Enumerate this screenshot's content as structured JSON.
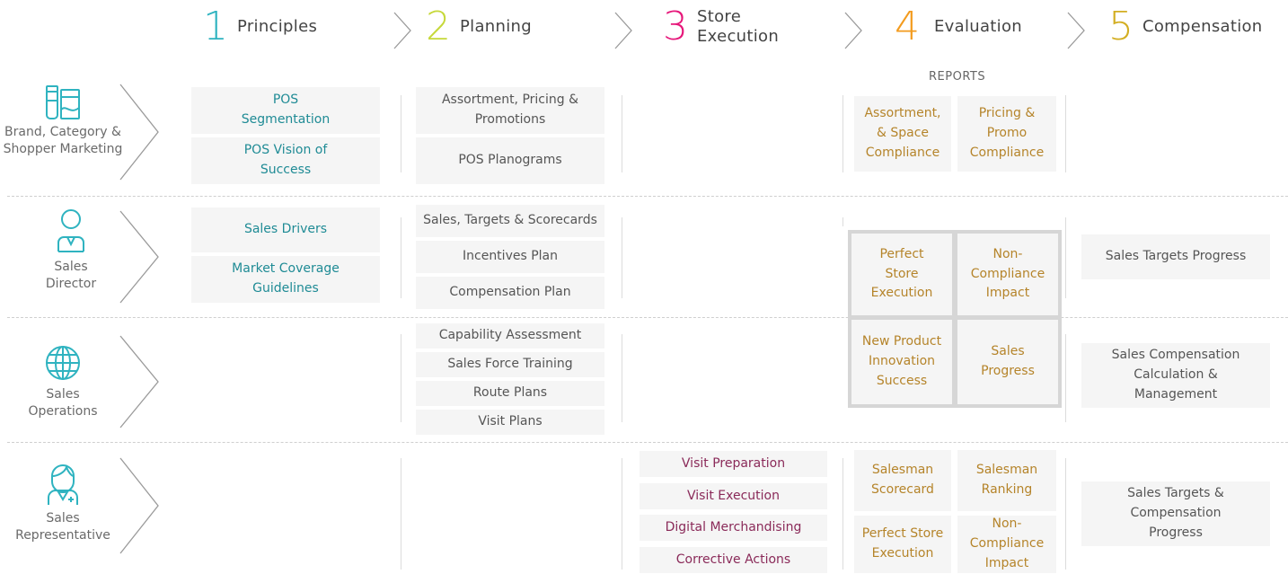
{
  "phases": [
    {
      "num": "1",
      "label": "Principles",
      "color": "#2fb3c0"
    },
    {
      "num": "2",
      "label": "Planning",
      "color": "#c6d83a"
    },
    {
      "num": "3",
      "label": "Store Execution",
      "color": "#e6177a"
    },
    {
      "num": "4",
      "label": "Evaluation",
      "color": "#f39b1e"
    },
    {
      "num": "5",
      "label": "Compensation",
      "color": "#d3ae22"
    }
  ],
  "roles": [
    {
      "label": "Brand, Category & Shopper Marketing",
      "icon": "brand-products-icon"
    },
    {
      "label": "Sales Director",
      "icon": "sales-director-icon"
    },
    {
      "label": "Sales Operations",
      "icon": "globe-icon"
    },
    {
      "label": "Sales Representative",
      "icon": "sales-representative-icon"
    }
  ],
  "principles": {
    "pos_segmentation": "POS Segmentation",
    "pos_vision": "POS Vision of Success",
    "sales_drivers": "Sales Drivers",
    "market_coverage": "Market Coverage Guidelines"
  },
  "planning": {
    "assortment": "Assortment, Pricing & Promotions",
    "planograms": "POS Planograms",
    "targets": "Sales, Targets & Scorecards",
    "incentives": "Incentives Plan",
    "compensation": "Compensation Plan",
    "capability": "Capability Assessment",
    "training": "Sales Force Training",
    "route": "Route Plans",
    "visit": "Visit Plans"
  },
  "execution": {
    "preparation": "Visit Preparation",
    "visit_execution": "Visit Execution",
    "digital": "Digital Merchandising",
    "corrective": "Corrective Actions"
  },
  "evaluation": {
    "reports_label": "REPORTS",
    "assortment_space": "Assortment, & Space Compliance",
    "pricing_promo": "Pricing & Promo Compliance",
    "perfect_store": "Perfect Store Execution",
    "non_compliance": "Non-Compliance Impact",
    "new_product": "New Product Innovation Success",
    "sales_progress": "Sales Progress",
    "salesman_scorecard": "Salesman Scorecard",
    "salesman_ranking": "Salesman Ranking",
    "perfect_store_rep": "Perfect Store Execution",
    "non_compliance_rep": "Non-Compliance Impact"
  },
  "compensation": {
    "targets_progress": "Sales Targets Progress",
    "calc_mgmt": "Sales Compensation Calculation & Management",
    "targets_comp": "Sales Targets & Compensation Progress"
  }
}
